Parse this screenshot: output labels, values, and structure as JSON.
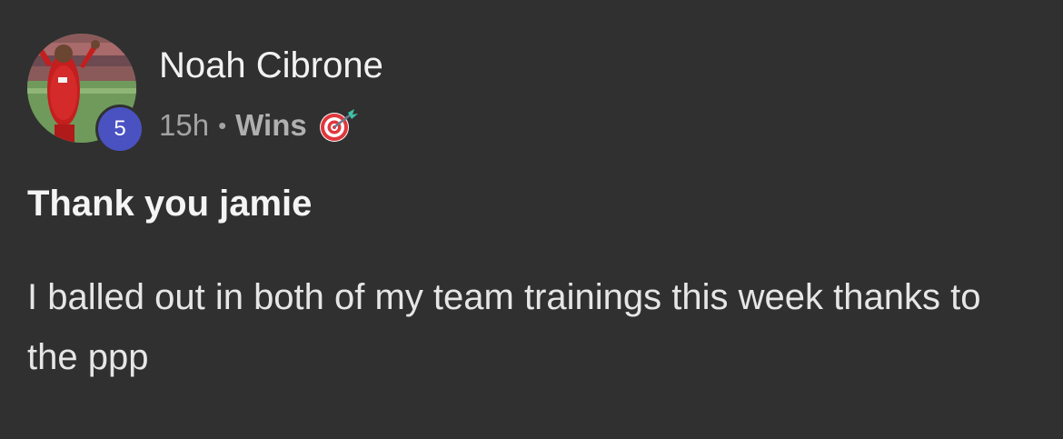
{
  "post": {
    "author": {
      "name": "Noah Cibrone",
      "level": "5",
      "avatar_icon": "footballer-avatar"
    },
    "meta": {
      "time_ago": "15h",
      "separator": "•",
      "category": "Wins",
      "category_icon": "dart-target-icon"
    },
    "title": "Thank you jamie",
    "body": "I balled out in both of my team trainings this week thanks to the ppp"
  },
  "colors": {
    "background": "#303030",
    "level_badge": "#4a52c2",
    "text_primary": "#f2f2f2",
    "text_secondary": "#a3a3a3"
  }
}
